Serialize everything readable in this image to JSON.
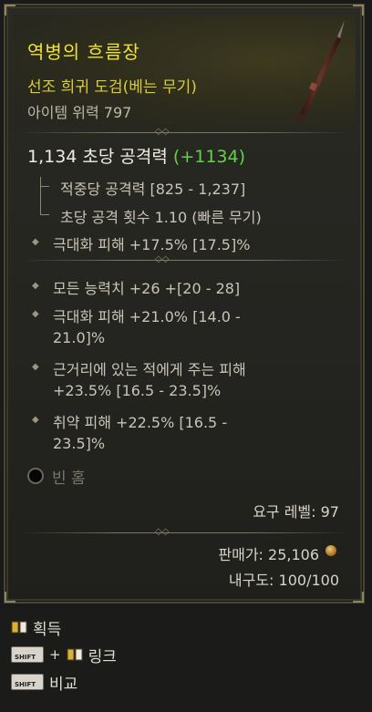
{
  "item": {
    "name": "역병의 흐름장",
    "type": "선조 희귀 도검(베는 무기)",
    "power": "아이템 위력 797"
  },
  "dps": {
    "text": "1,134 초당 공격력",
    "bonus": "(+1134)"
  },
  "weapon_stats": [
    "적중당 공격력 [825 - 1,237]",
    "초당 공격 횟수 1.10 (빠른 무기)"
  ],
  "implicit": "극대화 피해 +17.5% [17.5]%",
  "affixes": [
    {
      "line1": "모든 능력치 +26 +[20 - 28]",
      "line2": ""
    },
    {
      "line1": "극대화 피해 +21.0% [14.0 -",
      "line2": "21.0]%"
    },
    {
      "line1": "근거리에 있는 적에게 주는 피해",
      "line2": "+23.5% [16.5 - 23.5]%"
    },
    {
      "line1": "취약 피해 +22.5% [16.5 -",
      "line2": "23.5]%"
    }
  ],
  "socket": {
    "label": "빈 홈"
  },
  "requirement": "요구 레벨: 97",
  "sell_value": "판매가: 25,106",
  "durability": "내구도: 100/100",
  "footer": {
    "acquire": "획득",
    "link": "링크",
    "compare": "비교",
    "shift_key": "SHIFT",
    "plus": "+"
  },
  "colors": {
    "name": "#efe23a",
    "type": "#d9cd3a",
    "bonus": "#63d24b",
    "text": "#c9c4b6"
  },
  "icons": [
    "spear-item-icon",
    "socket-empty-icon",
    "gold-coin-icon",
    "book-icon",
    "shift-key-icon"
  ]
}
